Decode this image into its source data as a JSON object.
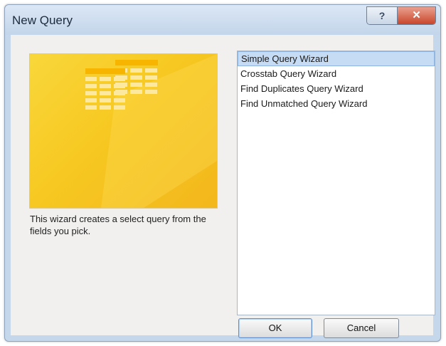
{
  "window": {
    "title": "New Query",
    "help_glyph": "?",
    "close_glyph": "✕"
  },
  "description": "This wizard creates a select query from the fields you pick.",
  "wizards": [
    {
      "label": "Simple Query Wizard",
      "selected": true
    },
    {
      "label": "Crosstab Query Wizard",
      "selected": false
    },
    {
      "label": "Find Duplicates Query Wizard",
      "selected": false
    },
    {
      "label": "Find Unmatched Query Wizard",
      "selected": false
    }
  ],
  "buttons": {
    "ok": "OK",
    "cancel": "Cancel"
  },
  "colors": {
    "preview_accent": "#f7c821",
    "selection": "#c6dcf5"
  }
}
